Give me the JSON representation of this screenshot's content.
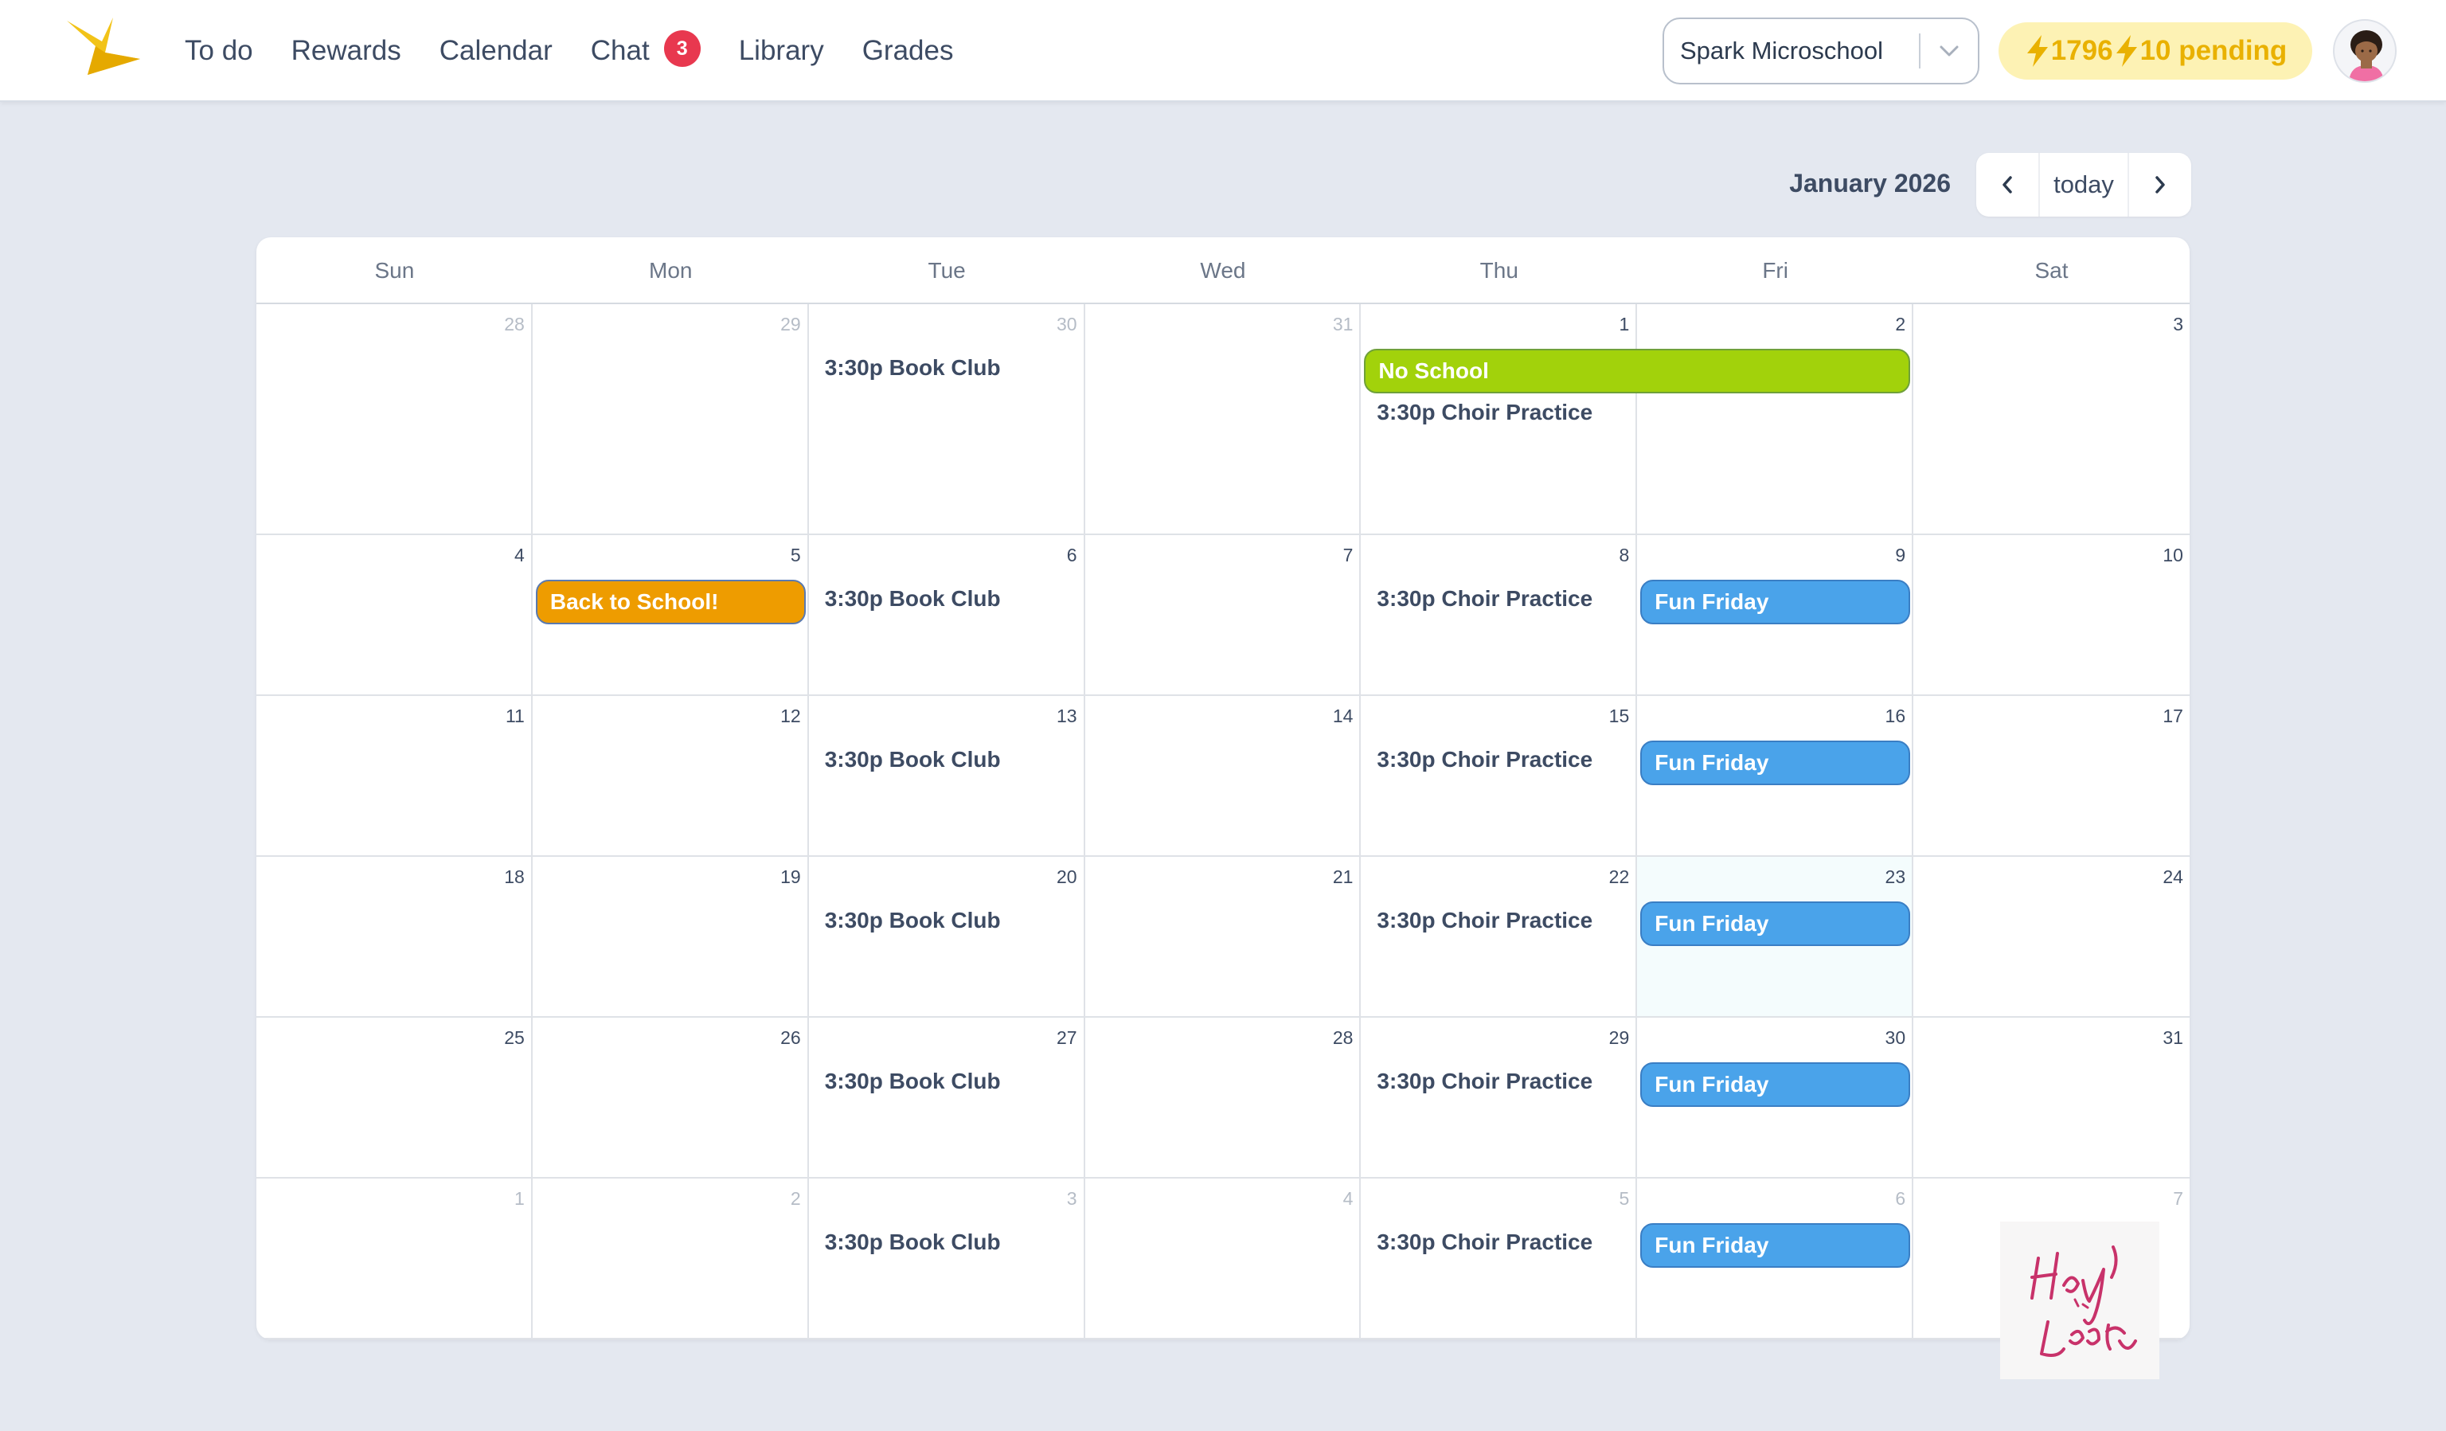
{
  "nav": {
    "links": [
      {
        "label": "To do"
      },
      {
        "label": "Rewards"
      },
      {
        "label": "Calendar"
      },
      {
        "label": "Chat",
        "badge": "3"
      },
      {
        "label": "Library"
      },
      {
        "label": "Grades"
      }
    ],
    "school": "Spark Microschool",
    "points": "1796",
    "pending": "10 pending"
  },
  "calendar": {
    "title": "January 2026",
    "today_label": "today",
    "days_of_week": [
      "Sun",
      "Mon",
      "Tue",
      "Wed",
      "Thu",
      "Fri",
      "Sat"
    ],
    "weeks": [
      [
        {
          "day": "28",
          "other": true
        },
        {
          "day": "29",
          "other": true
        },
        {
          "day": "30",
          "other": true,
          "events": [
            "3:30p Book Club"
          ]
        },
        {
          "day": "31",
          "other": true
        },
        {
          "day": "1",
          "events": [
            "3:30p Choir Practice"
          ]
        },
        {
          "day": "2"
        },
        {
          "day": "3"
        }
      ],
      [
        {
          "day": "4"
        },
        {
          "day": "5",
          "allday": "Back to School!"
        },
        {
          "day": "6",
          "events": [
            "3:30p Book Club"
          ]
        },
        {
          "day": "7"
        },
        {
          "day": "8",
          "events": [
            "3:30p Choir Practice"
          ]
        },
        {
          "day": "9",
          "allday": "Fun Friday"
        },
        {
          "day": "10"
        }
      ],
      [
        {
          "day": "11"
        },
        {
          "day": "12"
        },
        {
          "day": "13",
          "events": [
            "3:30p Book Club"
          ]
        },
        {
          "day": "14"
        },
        {
          "day": "15",
          "events": [
            "3:30p Choir Practice"
          ]
        },
        {
          "day": "16",
          "allday": "Fun Friday"
        },
        {
          "day": "17"
        }
      ],
      [
        {
          "day": "18"
        },
        {
          "day": "19"
        },
        {
          "day": "20",
          "events": [
            "3:30p Book Club"
          ]
        },
        {
          "day": "21"
        },
        {
          "day": "22",
          "events": [
            "3:30p Choir Practice"
          ]
        },
        {
          "day": "23",
          "today": true,
          "allday": "Fun Friday"
        },
        {
          "day": "24"
        }
      ],
      [
        {
          "day": "25"
        },
        {
          "day": "26"
        },
        {
          "day": "27",
          "events": [
            "3:30p Book Club"
          ]
        },
        {
          "day": "28"
        },
        {
          "day": "29",
          "events": [
            "3:30p Choir Practice"
          ]
        },
        {
          "day": "30",
          "allday": "Fun Friday"
        },
        {
          "day": "31"
        }
      ],
      [
        {
          "day": "1",
          "other": true
        },
        {
          "day": "2",
          "other": true
        },
        {
          "day": "3",
          "other": true,
          "events": [
            "3:30p Book Club"
          ]
        },
        {
          "day": "4",
          "other": true
        },
        {
          "day": "5",
          "other": true,
          "events": [
            "3:30p Choir Practice"
          ]
        },
        {
          "day": "6",
          "other": true,
          "allday": "Fun Friday"
        },
        {
          "day": "7",
          "other": true
        }
      ]
    ],
    "spanning_event": "No School"
  },
  "colors": {
    "no_school": "#a2d20b",
    "back_to_school": "#ee9c00",
    "fun_friday": "#4aa3ea",
    "chat_badge": "#e8384f",
    "points_text": "#e9b100"
  },
  "watermark": "Hay, y no Loar"
}
